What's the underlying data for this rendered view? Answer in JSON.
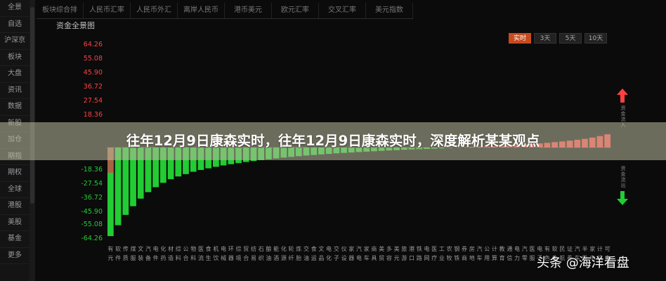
{
  "sidebar": {
    "items": [
      "全景",
      "自选",
      "沪深京",
      "板块",
      "大盘",
      "资讯",
      "数据",
      "新股",
      "加仓",
      "期指",
      "期权",
      "全球",
      "港股",
      "美股",
      "基金",
      "更多"
    ]
  },
  "tabs": [
    "板块综合排",
    "人民币汇率",
    "人民币外汇",
    "离岸人民币",
    "港币美元",
    "欧元汇率",
    "交叉汇率",
    "美元指数"
  ],
  "chart": {
    "title": "资金全景图",
    "periods": [
      "实时",
      "3天",
      "5天",
      "10天"
    ],
    "active_period": "实时",
    "up_color": "#ff4040",
    "down_color": "#22cc33"
  },
  "chart_data": {
    "type": "bar",
    "ylabel": "",
    "yticks": [
      "64.26",
      "55.08",
      "45.90",
      "36.72",
      "27.54",
      "18.36",
      "",
      "",
      "-18.36",
      "-27.54",
      "-36.72",
      "-45.90",
      "-55.08",
      "-64.26"
    ],
    "ylim": [
      -64.26,
      64.26
    ],
    "values": [
      -64.3,
      -56.4,
      -48.9,
      -42.6,
      -37.1,
      -32.4,
      -28.8,
      -25.6,
      -23.0,
      -21.0,
      -19.3,
      -17.6,
      -16.3,
      -15.1,
      -14.0,
      -13.0,
      -12.1,
      -11.3,
      -10.5,
      -9.8,
      -9.1,
      -8.5,
      -7.9,
      -7.3,
      -6.8,
      -6.3,
      -5.8,
      -5.4,
      -5.0,
      -4.6,
      -4.2,
      -3.9,
      -3.6,
      -3.3,
      -3.0,
      -2.7,
      -2.4,
      -2.1,
      -1.9,
      -1.6,
      -1.4,
      -1.2,
      -1.0,
      -0.8,
      -0.6,
      -0.4,
      -0.2,
      0.2,
      0.4,
      0.6,
      0.8,
      1.0,
      1.3,
      1.6,
      1.9,
      2.2,
      2.6,
      3.0,
      3.4,
      3.9,
      4.4,
      5.0,
      5.6,
      6.3,
      7.2,
      8.3,
      9.6
    ],
    "categories_line1": "有软传煤文汽电化材综公物医食机电环综贸纺石酿能化轮炼交食文电交仪家汽家商美多美旅港铁电医工农钢券房汽公计教通电汽医电有软民证汽半家计可",
    "categories_line2": "元件质服装备件药造料合料流生饮械器境合易织油酒源纤胎油运品化子设器电车具贸容元游口路网疗业牧铁商地车用算育信力零服子色件航券车导电机电"
  },
  "banner": {
    "text": "往年12月9日康森实时，往年12月9日康森实时，深度解析某某观点"
  },
  "right_labels": {
    "top": "资金流入",
    "bottom": "资金流出"
  },
  "watermark": {
    "text": "头条 @海洋看盘"
  }
}
